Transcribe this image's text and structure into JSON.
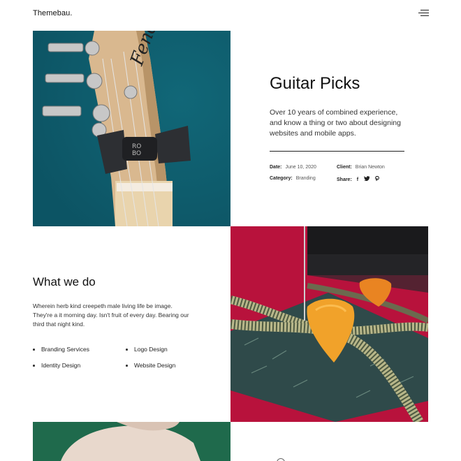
{
  "header": {
    "logo": "Themebau."
  },
  "project": {
    "title": "Guitar Picks",
    "description": "Over 10 years of combined experience, and know a thing or two about designing websites and mobile apps.",
    "meta": {
      "date_label": "Date:",
      "date_value": "June 10, 2020",
      "client_label": "Client:",
      "client_value": "Brian Newton",
      "category_label": "Category:",
      "category_value": "Branding",
      "share_label": "Share:",
      "share_icons": [
        "facebook-icon",
        "twitter-icon",
        "pinterest-icon"
      ]
    }
  },
  "services": {
    "title": "What we do",
    "description": "Wherein herb kind creepeth male living life be image. They're a it morning day. Isn't fruit of every day. Bearing our third that night kind.",
    "items": [
      "Branding Services",
      "Logo Design",
      "Identity Design",
      "Website Design"
    ]
  },
  "colors": {
    "guitar_bg": "#0f5e6f",
    "picks_bg": "#b8123c",
    "hand_bg": "#1f6a4c",
    "pick_orange": "#f1a22a"
  }
}
